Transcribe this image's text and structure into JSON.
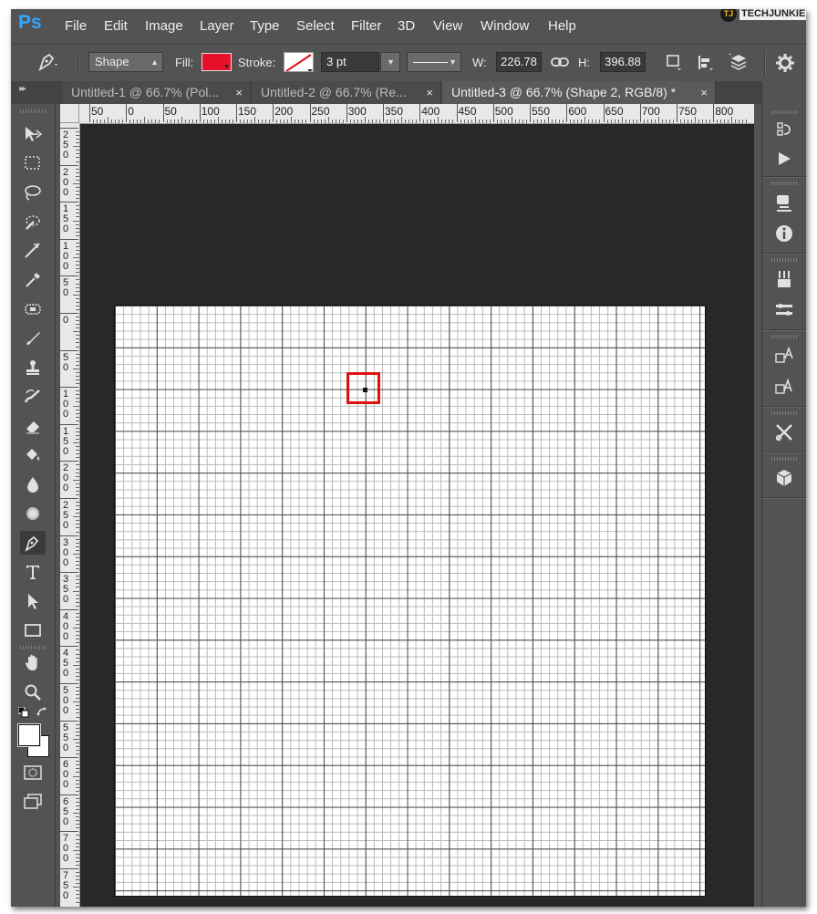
{
  "menubar": {
    "logo": "Ps",
    "items": [
      "File",
      "Edit",
      "Image",
      "Layer",
      "Type",
      "Select",
      "Filter",
      "3D",
      "View",
      "Window",
      "Help"
    ],
    "watermark_mark": "TJ",
    "watermark": "TECHJUNKIE"
  },
  "options": {
    "tool_mode": "Shape",
    "fill_label": "Fill:",
    "fill_color": "#e8102a",
    "stroke_label": "Stroke:",
    "stroke_width": "3 pt",
    "w_label": "W:",
    "w_value": "226.78",
    "h_label": "H:",
    "h_value": "396.88"
  },
  "tabs": [
    {
      "label": "Untitled-1 @ 66.7% (Pol...",
      "close": "×",
      "active": false
    },
    {
      "label": "Untitled-2 @ 66.7% (Re...",
      "close": "×",
      "active": false
    },
    {
      "label": "Untitled-3 @ 66.7% (Shape 2, RGB/8) *",
      "close": "×",
      "active": true
    }
  ],
  "ruler_h": [
    "50",
    "0",
    "50",
    "100",
    "150",
    "200",
    "250",
    "300",
    "350",
    "400",
    "450",
    "500",
    "550",
    "600",
    "650",
    "700",
    "750",
    "800"
  ],
  "ruler_v": [
    "2 5 0",
    "2 0 0",
    "1 5 0",
    "1 0 0",
    "5 0",
    "0",
    "5 0",
    "1 0 0",
    "1 5 0",
    "2 0 0",
    "2 5 0",
    "3 0 0",
    "3 5 0",
    "4 0 0",
    "4 5 0",
    "5 0 0",
    "5 5 0",
    "6 0 0",
    "6 5 0",
    "7 0 0",
    "7 5 0"
  ],
  "accent": {
    "selection_box": "#e01010",
    "workspace_bg": "#282828",
    "ui_bg": "#535353"
  }
}
